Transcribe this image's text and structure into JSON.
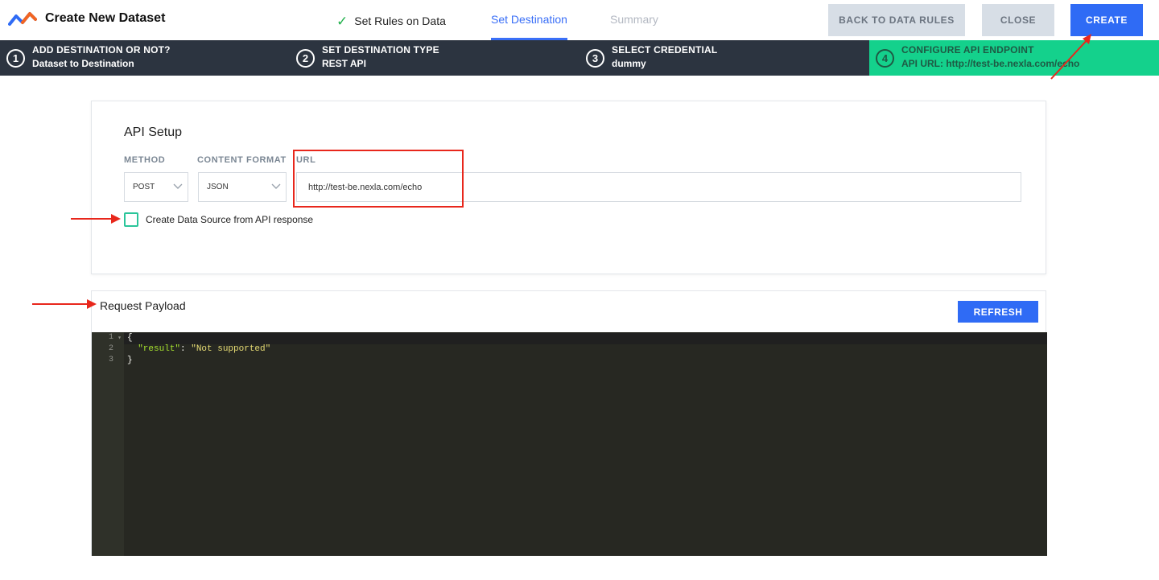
{
  "header": {
    "title": "Create New Dataset",
    "tabs": [
      {
        "label": "Set Rules on Data",
        "state": "done"
      },
      {
        "label": "Set Destination",
        "state": "active"
      },
      {
        "label": "Summary",
        "state": "disabled"
      }
    ],
    "buttons": {
      "back": "BACK TO DATA RULES",
      "close": "CLOSE",
      "create": "CREATE"
    }
  },
  "steps": [
    {
      "num": "1",
      "title": "ADD DESTINATION OR NOT?",
      "value": "Dataset to Destination"
    },
    {
      "num": "2",
      "title": "SET DESTINATION TYPE",
      "value": "REST API"
    },
    {
      "num": "3",
      "title": "SELECT CREDENTIAL",
      "value": "dummy"
    },
    {
      "num": "4",
      "title": "CONFIGURE API ENDPOINT",
      "value": "API URL: http://test-be.nexla.com/echo"
    }
  ],
  "api_setup": {
    "title": "API Setup",
    "method_label": "METHOD",
    "method_value": "POST",
    "format_label": "CONTENT FORMAT",
    "format_value": "JSON",
    "url_label": "URL",
    "url_value": "http://test-be.nexla.com/echo",
    "checkbox_label": "Create Data Source from API response"
  },
  "payload": {
    "title": "Request Payload",
    "refresh": "REFRESH",
    "line_numbers": [
      "1",
      "2",
      "3"
    ],
    "open_brace": "{",
    "key": "\"result\"",
    "sep": ": ",
    "value": "\"Not supported\"",
    "close_brace": "}"
  },
  "colors": {
    "accent": "#2f6bf5",
    "stepper_bg": "#2c3440",
    "active_step": "#14d18c",
    "annotation": "#e8271c",
    "editor_bg": "#272822"
  }
}
